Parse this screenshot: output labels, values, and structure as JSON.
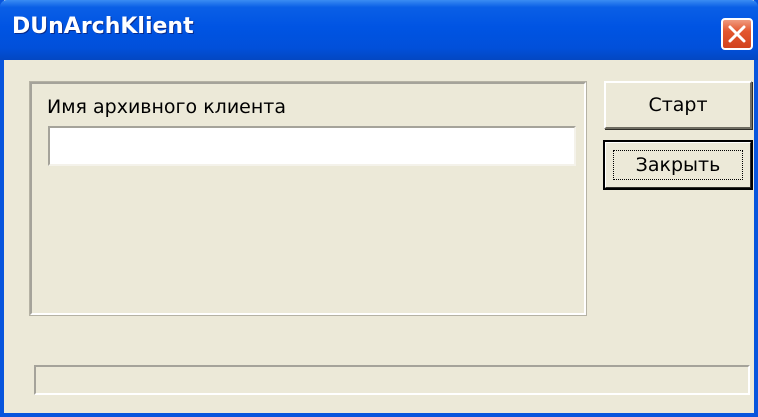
{
  "window": {
    "title": "DUnArchKlient",
    "close_icon": "close-icon"
  },
  "form": {
    "field_label": "Имя архивного клиента",
    "client_name_value": "",
    "client_name_placeholder": ""
  },
  "buttons": {
    "start_label": "Старт",
    "close_label": "Закрыть"
  },
  "status": {
    "text": ""
  },
  "colors": {
    "titlebar": "#0054E3",
    "window_bg": "#ECE9D8",
    "close_button": "#E3572F"
  }
}
